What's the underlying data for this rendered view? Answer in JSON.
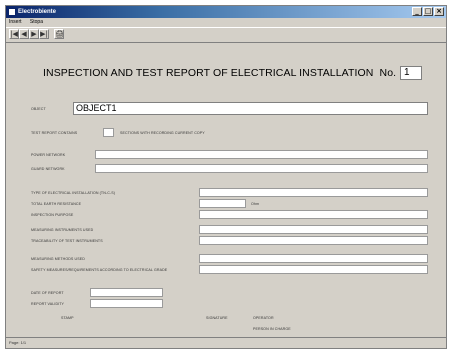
{
  "window": {
    "title": "Electrobiente",
    "controls": [
      "_",
      "□",
      "×"
    ]
  },
  "menu": [
    "Insert",
    "Stopa"
  ],
  "toolbar": {
    "buttons": [
      "|◀",
      "◀",
      "▶",
      "▶|",
      "🖨"
    ]
  },
  "report": {
    "title": "INSPECTION AND TEST REPORT OF ELECTRICAL INSTALLATION",
    "no_label": "No.",
    "no_value": "1",
    "object_label": "OBJECT",
    "object_value": "OBJECT1",
    "test_report_contains_label": "TEST REPORT CONTAINS",
    "sections_label": "SECTIONS WITH RECORDING CURRENT COPY",
    "power_network_label": "POWER NETWORK",
    "guard_network_label": "GUARD NETWORK",
    "installation_type_label": "TYPE OF ELECTRICAL INSTALLATION (TN-C-S)",
    "earth_resistance_label": "TOTAL EARTH RESISTANCE",
    "ohm_unit": "Ohm",
    "inspection_purpose_label": "INSPECTION PURPOSE",
    "instruments_label": "MEASURING INSTRUMENTS USED",
    "traceability_label": "TRACEABILITY OF TEST INSTRUMENTS",
    "methods_label": "MEASURING METHODS USED",
    "safety_measures_label": "SAFETY MEASURES/REQUIREMENTS ACCORDING TO ELECTRICAL GRADE",
    "date_label": "DATE OF REPORT",
    "valid_label": "REPORT VALIDITY",
    "stamp_label": "STAMP",
    "signature_label": "SIGNATURE",
    "operator_label": "OPERATOR",
    "person_in_charge_label": "PERSON IN CHARGE"
  },
  "status": {
    "text": "Page: 1/1"
  }
}
